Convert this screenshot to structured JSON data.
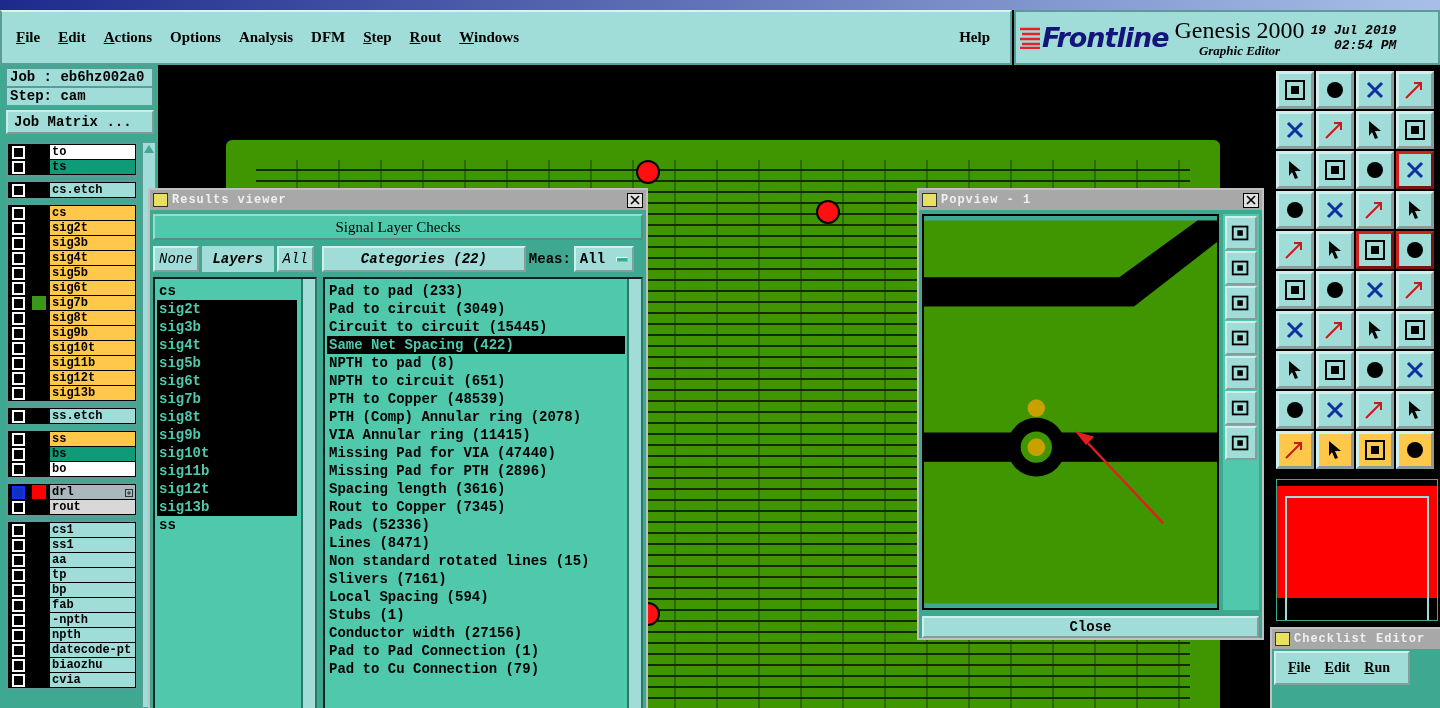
{
  "menu_bar": {
    "items": [
      {
        "label": "File",
        "mnemonic": true
      },
      {
        "label": "Edit",
        "mnemonic": true
      },
      {
        "label": "Actions",
        "mnemonic": true
      },
      {
        "label": "Options",
        "mnemonic": false
      },
      {
        "label": "Analysis",
        "mnemonic": false
      },
      {
        "label": "DFM",
        "mnemonic": false
      },
      {
        "label": "Step",
        "mnemonic": true
      },
      {
        "label": "Rout",
        "mnemonic": true
      },
      {
        "label": "Windows",
        "mnemonic": true
      }
    ],
    "help": {
      "label": "Help",
      "mnemonic": false
    }
  },
  "brand": {
    "logo": "Frontline",
    "product": "Genesis 2000",
    "subtitle": "Graphic Editor",
    "date": "19 Jul 2019",
    "time": "02:54 PM"
  },
  "job": {
    "job": "Job : eb6hz002a0",
    "step": "Step: cam",
    "matrix_button": "Job Matrix ..."
  },
  "layer_groups": [
    [
      {
        "name": "to",
        "color": "#ffffff",
        "selected": false,
        "expandable": false
      },
      {
        "name": "ts",
        "color": "#0f9b78",
        "selected": false,
        "expandable": false
      }
    ],
    [
      {
        "name": "cs.etch",
        "color": "#a0dcd8",
        "selected": false,
        "expandable": false
      }
    ],
    [
      {
        "name": "cs",
        "color": "#ffc84a",
        "selected": false,
        "expandable": false
      },
      {
        "name": "sig2t",
        "color": "#ffc84a",
        "selected": false,
        "expandable": false
      },
      {
        "name": "sig3b",
        "color": "#ffc84a",
        "selected": false,
        "expandable": false
      },
      {
        "name": "sig4t",
        "color": "#ffc84a",
        "selected": false,
        "expandable": false
      },
      {
        "name": "sig5b",
        "color": "#ffc84a",
        "selected": false,
        "expandable": false
      },
      {
        "name": "sig6t",
        "color": "#ffc84a",
        "selected": false,
        "expandable": false
      },
      {
        "name": "sig7b",
        "color": "#ffc84a",
        "swatch": {
          "color": "#3c961c"
        },
        "selected": false,
        "expandable": false
      },
      {
        "name": "sig8t",
        "color": "#ffc84a",
        "selected": false,
        "expandable": false
      },
      {
        "name": "sig9b",
        "color": "#ffc84a",
        "selected": false,
        "expandable": false
      },
      {
        "name": "sig10t",
        "color": "#ffc84a",
        "selected": false,
        "expandable": false
      },
      {
        "name": "sig11b",
        "color": "#ffc84a",
        "selected": false,
        "expandable": false
      },
      {
        "name": "sig12t",
        "color": "#ffc84a",
        "selected": false,
        "expandable": false
      },
      {
        "name": "sig13b",
        "color": "#ffc84a",
        "selected": false,
        "expandable": false
      }
    ],
    [
      {
        "name": "ss.etch",
        "color": "#a0dcd8",
        "selected": false,
        "expandable": false
      }
    ],
    [
      {
        "name": "ss",
        "color": "#ffc84a",
        "selected": false,
        "expandable": false
      },
      {
        "name": "bs",
        "color": "#0f9b78",
        "selected": false,
        "expandable": false
      },
      {
        "name": "bo",
        "color": "#ffffff",
        "selected": false,
        "expandable": false
      }
    ],
    [
      {
        "name": "drl",
        "color": "#a8b8bc",
        "swatch": {
          "color": "#ff0000"
        },
        "selected": true,
        "expandable": true
      },
      {
        "name": "rout",
        "color": "#d8d8d8",
        "selected": false,
        "expandable": false
      }
    ],
    [
      {
        "name": "cs1",
        "color": "#a0dcd8",
        "selected": false,
        "expandable": false
      },
      {
        "name": "ss1",
        "color": "#a0dcd8",
        "selected": false,
        "expandable": false
      },
      {
        "name": "aa",
        "color": "#a0dcd8",
        "selected": false,
        "expandable": false
      },
      {
        "name": "tp",
        "color": "#a0dcd8",
        "selected": false,
        "expandable": false
      },
      {
        "name": "bp",
        "color": "#a0dcd8",
        "selected": false,
        "expandable": false
      },
      {
        "name": "fab",
        "color": "#a0dcd8",
        "selected": false,
        "expandable": false
      },
      {
        "name": "-npth",
        "color": "#a0dcd8",
        "selected": false,
        "expandable": false
      },
      {
        "name": "npth",
        "color": "#a0dcd8",
        "selected": false,
        "expandable": false
      },
      {
        "name": "datecode-pt",
        "color": "#a0dcd8",
        "selected": false,
        "expandable": false
      },
      {
        "name": "biaozhu",
        "color": "#a0dcd8",
        "selected": false,
        "expandable": false
      },
      {
        "name": "cvia",
        "color": "#a0dcd8",
        "selected": false,
        "expandable": false
      }
    ]
  ],
  "results_viewer": {
    "title": "Results viewer",
    "header": "Signal Layer Checks",
    "none_button": "None",
    "layers_label": "Layers",
    "all_button": "All",
    "categories_button": "Categories (22)",
    "meas_label": "Meas:",
    "meas_value": "All",
    "layers": [
      {
        "name": "cs",
        "selected": false
      },
      {
        "name": "sig2t",
        "selected": true
      },
      {
        "name": "sig3b",
        "selected": true
      },
      {
        "name": "sig4t",
        "selected": true
      },
      {
        "name": "sig5b",
        "selected": true
      },
      {
        "name": "sig6t",
        "selected": true
      },
      {
        "name": "sig7b",
        "selected": true
      },
      {
        "name": "sig8t",
        "selected": true
      },
      {
        "name": "sig9b",
        "selected": true
      },
      {
        "name": "sig10t",
        "selected": true
      },
      {
        "name": "sig11b",
        "selected": true
      },
      {
        "name": "sig12t",
        "selected": true
      },
      {
        "name": "sig13b",
        "selected": true
      },
      {
        "name": "ss",
        "selected": false
      }
    ],
    "categories": [
      {
        "label": "Pad to pad (233)",
        "selected": false
      },
      {
        "label": "Pad to circuit (3049)",
        "selected": false
      },
      {
        "label": "Circuit to circuit (15445)",
        "selected": false
      },
      {
        "label": "Same Net Spacing (422)",
        "selected": true
      },
      {
        "label": "NPTH to pad (8)",
        "selected": false
      },
      {
        "label": "NPTH to circuit (651)",
        "selected": false
      },
      {
        "label": "PTH to Copper (48539)",
        "selected": false
      },
      {
        "label": "PTH (Comp) Annular ring (2078)",
        "selected": false
      },
      {
        "label": "VIA Annular ring (11415)",
        "selected": false
      },
      {
        "label": "Missing Pad for VIA (47440)",
        "selected": false
      },
      {
        "label": "Missing Pad for PTH (2896)",
        "selected": false
      },
      {
        "label": "Spacing length (3616)",
        "selected": false
      },
      {
        "label": "Rout to Copper (7345)",
        "selected": false
      },
      {
        "label": "Pads (52336)",
        "selected": false
      },
      {
        "label": "Lines (8471)",
        "selected": false
      },
      {
        "label": "Non standard rotated lines (15)",
        "selected": false
      },
      {
        "label": "Slivers (7161)",
        "selected": false
      },
      {
        "label": "Local Spacing (594)",
        "selected": false
      },
      {
        "label": "Stubs (1)",
        "selected": false
      },
      {
        "label": "Conductor width (27156)",
        "selected": false
      },
      {
        "label": "Pad to Pad Connection (1)",
        "selected": false
      },
      {
        "label": "Pad to Cu Connection (79)",
        "selected": false
      }
    ]
  },
  "popview": {
    "title": "Popview - 1",
    "close_button": "Close"
  },
  "checklist_editor": {
    "title": "Checklist Editor",
    "menu": [
      {
        "label": "File",
        "mnemonic": true
      },
      {
        "label": "Edit",
        "mnemonic": true
      },
      {
        "label": "Run",
        "mnemonic": true
      }
    ]
  }
}
